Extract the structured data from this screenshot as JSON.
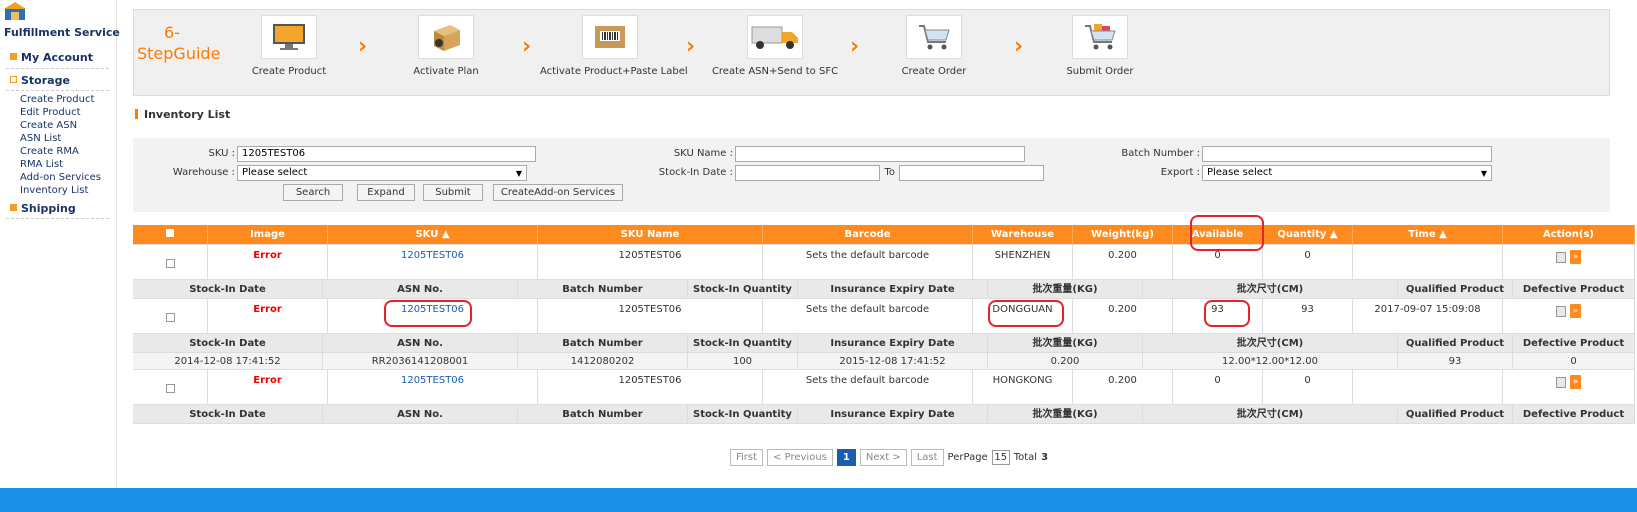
{
  "sidebar": {
    "title": "Fulfillment Service",
    "sections": {
      "my_account": "My Account",
      "storage": "Storage",
      "shipping": "Shipping"
    },
    "storage_items": [
      "Create Product",
      "Edit Product",
      "Create ASN",
      "ASN List",
      "Create RMA",
      "RMA List",
      "Add-on Services",
      "Inventory List"
    ]
  },
  "guide": {
    "title": "6-StepGuide",
    "steps": [
      "Create Product",
      "Activate Plan",
      "Activate Product+Paste Label",
      "Create ASN+Send to SFC",
      "Create Order",
      "Submit Order"
    ]
  },
  "inventory": {
    "title": "Inventory List"
  },
  "filters": {
    "sku_label": "SKU :",
    "sku_value": "1205TEST06",
    "sku_name_label": "SKU Name :",
    "batch_label": "Batch Number :",
    "warehouse_label": "Warehouse :",
    "warehouse_value": "Please select",
    "stockin_label": "Stock-In Date :",
    "to_label": "To",
    "export_label": "Export :",
    "export_value": "Please select",
    "buttons": {
      "search": "Search",
      "expand": "Expand",
      "submit": "Submit",
      "addon": "CreateAdd-on Services"
    }
  },
  "table": {
    "headers": [
      "Image",
      "SKU ▲",
      "SKU Name",
      "Barcode",
      "Warehouse",
      "Weight(kg)",
      "Available",
      "Quantity ▲",
      "Time ▲",
      "Action(s)"
    ],
    "sub_headers": [
      "Stock-In Date",
      "ASN No.",
      "Batch Number",
      "Stock-In Quantity",
      "Insurance Expiry Date",
      "批次重量(KG)",
      "批次尺寸(CM)",
      "Qualified Product",
      "Defective Product"
    ],
    "rows": [
      {
        "image": "Error",
        "sku": "1205TEST06",
        "sku_name": "1205TEST06",
        "barcode": "Sets the default barcode",
        "warehouse": "SHENZHEN",
        "weight": "0.200",
        "available": "0",
        "quantity": "0",
        "time": ""
      },
      {
        "image": "Error",
        "sku": "1205TEST06",
        "sku_name": "1205TEST06",
        "barcode": "Sets the default barcode",
        "warehouse": "DONGGUAN",
        "weight": "0.200",
        "available": "93",
        "quantity": "93",
        "time": "2017-09-07 15:09:08"
      },
      {
        "image": "Error",
        "sku": "1205TEST06",
        "sku_name": "1205TEST06",
        "barcode": "Sets the default barcode",
        "warehouse": "HONGKONG",
        "weight": "0.200",
        "available": "0",
        "quantity": "0",
        "time": ""
      }
    ],
    "detail": {
      "stockin_date": "2014-12-08 17:41:52",
      "asn_no": "RR2036141208001",
      "batch_number": "1412080202",
      "stockin_qty": "100",
      "insurance_expiry": "2015-12-08 17:41:52",
      "batch_weight": "0.200",
      "batch_size": "12.00*12.00*12.00",
      "qualified": "93",
      "defective": "0"
    }
  },
  "pager": {
    "first": "First",
    "previous": "< Previous",
    "current": "1",
    "next": "Next >",
    "last": "Last",
    "per_page_label": "PerPage",
    "per_page": "15",
    "total_label": "Total",
    "total": "3"
  },
  "colors": {
    "accent": "#ff8a1e",
    "link": "#1a5cb0",
    "highlight": "#e5222b",
    "footer": "#1a8fe8"
  }
}
